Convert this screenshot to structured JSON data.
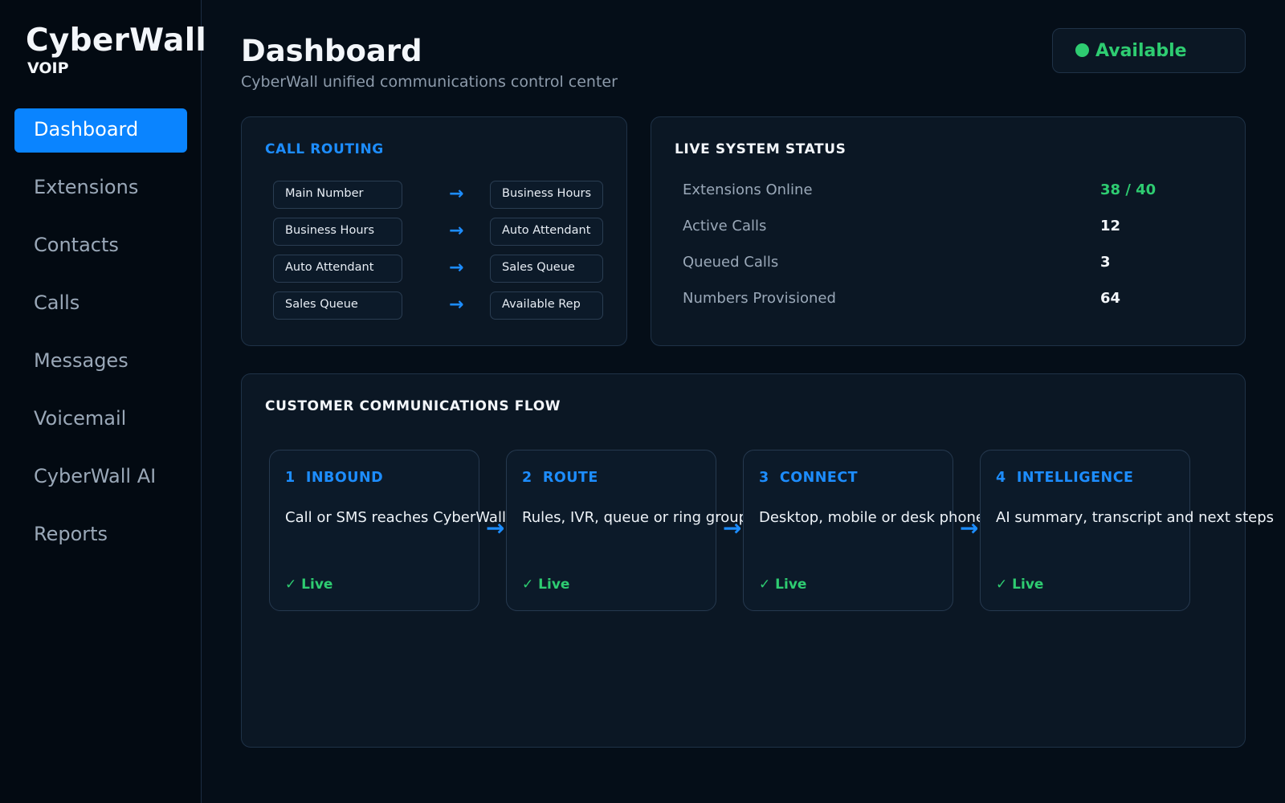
{
  "brand": {
    "name": "CyberWall",
    "sub": "VOIP"
  },
  "sidebar": {
    "items": [
      {
        "label": "Dashboard",
        "active": true
      },
      {
        "label": "Extensions"
      },
      {
        "label": "Contacts"
      },
      {
        "label": "Calls"
      },
      {
        "label": "Messages"
      },
      {
        "label": "Voicemail"
      },
      {
        "label": "CyberWall AI"
      },
      {
        "label": "Reports"
      }
    ]
  },
  "header": {
    "title": "Dashboard",
    "subtitle": "CyberWall unified communications control center",
    "status": "Available",
    "status_color": "#2ecc71"
  },
  "call_routing": {
    "title": "CALL ROUTING",
    "routes": [
      {
        "from": "Main Number",
        "to": "Business Hours"
      },
      {
        "from": "Business Hours",
        "to": "Auto Attendant"
      },
      {
        "from": "Auto Attendant",
        "to": "Sales Queue"
      },
      {
        "from": "Sales Queue",
        "to": "Available Rep"
      }
    ],
    "arrow": "→"
  },
  "system_status": {
    "title": "LIVE SYSTEM STATUS",
    "stats": [
      {
        "label": "Extensions Online",
        "value": "38 / 40"
      },
      {
        "label": "Active Calls",
        "value": "12"
      },
      {
        "label": "Queued Calls",
        "value": "3"
      },
      {
        "label": "Numbers Provisioned",
        "value": "64"
      }
    ]
  },
  "flow": {
    "title": "CUSTOMER COMMUNICATIONS FLOW",
    "arrow": "→",
    "steps": [
      {
        "title": "1  INBOUND",
        "desc": "Call or SMS reaches CyberWall",
        "status": "✓ Live"
      },
      {
        "title": "2  ROUTE",
        "desc": "Rules, IVR, queue or ring group",
        "status": "✓ Live"
      },
      {
        "title": "3  CONNECT",
        "desc": "Desktop, mobile or desk phone",
        "status": "✓ Live"
      },
      {
        "title": "4  INTELLIGENCE",
        "desc": "AI summary, transcript and next steps",
        "status": "✓ Live"
      }
    ]
  },
  "colors": {
    "accent": "#0a84ff",
    "accent_text": "#1d8dff",
    "success": "#2ecc71",
    "background": "#050e18"
  }
}
